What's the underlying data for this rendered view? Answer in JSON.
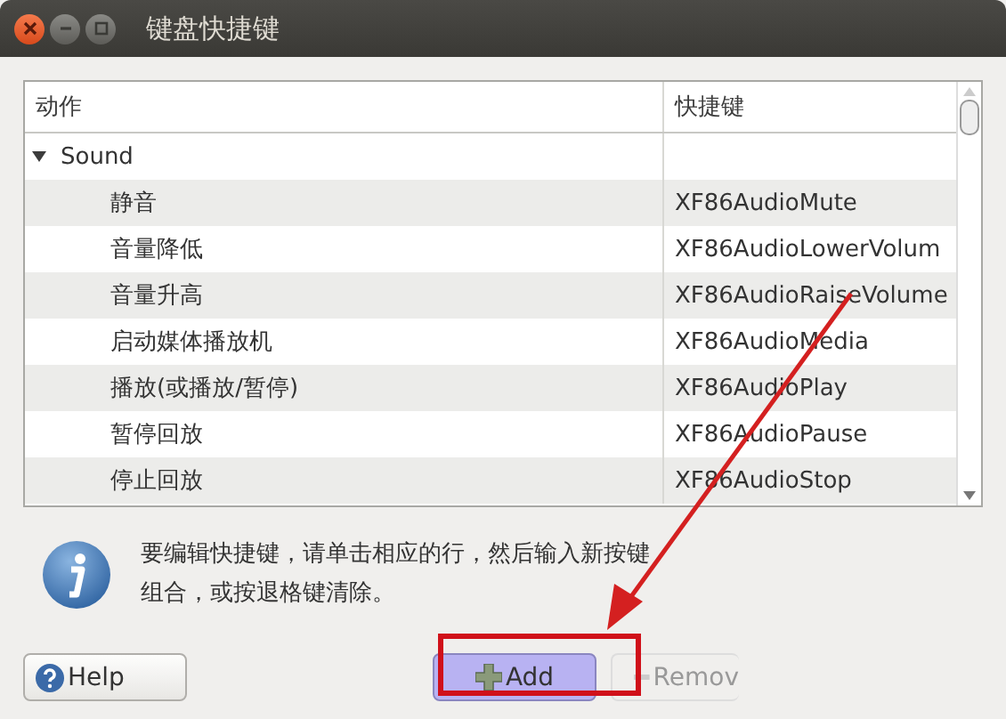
{
  "window": {
    "title": "键盘快捷键"
  },
  "table": {
    "columns": [
      "动作",
      "快捷键"
    ],
    "rows": [
      {
        "action": "Sound",
        "shortcut": "",
        "expanded": true,
        "children": [
          {
            "action": "静音",
            "shortcut": "XF86AudioMute"
          },
          {
            "action": "音量降低",
            "shortcut": "XF86AudioLowerVolum"
          },
          {
            "action": "音量升高",
            "shortcut": "XF86AudioRaiseVolume"
          },
          {
            "action": "启动媒体播放机",
            "shortcut": "XF86AudioMedia"
          },
          {
            "action": "播放(或播放/暂停)",
            "shortcut": "XF86AudioPlay"
          },
          {
            "action": "暂停回放",
            "shortcut": "XF86AudioPause"
          },
          {
            "action": "停止回放",
            "shortcut": "XF86AudioStop"
          }
        ]
      }
    ]
  },
  "info": {
    "text": "要编辑快捷键，请单击相应的行，然后输入新按键组合，或按退格键清除。"
  },
  "buttons": [
    {
      "kind": "help",
      "label": "Help",
      "disabled": false,
      "highlighted": false
    },
    {
      "kind": "add",
      "label": "Add",
      "disabled": false,
      "highlighted": true
    },
    {
      "kind": "remove",
      "label": "Remov",
      "disabled": true,
      "highlighted": false
    }
  ]
}
